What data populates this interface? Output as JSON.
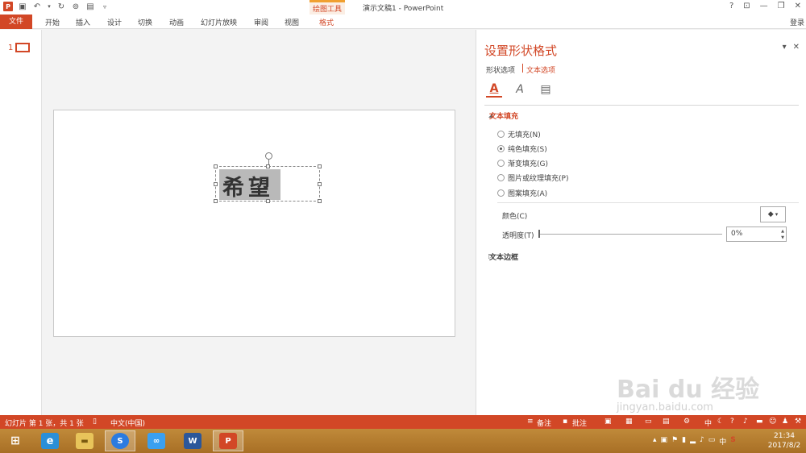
{
  "titlebar": {
    "doc_title": "演示文稿1 - PowerPoint",
    "tool_group": "绘图工具",
    "qat_icons": [
      "powerpoint-icon",
      "save-icon",
      "undo-icon",
      "redo-icon",
      "start-from-beginning-icon",
      "image-icon",
      "customize-qat-icon"
    ],
    "window_controls": [
      "?",
      "⊡",
      "—",
      "❐",
      "✕"
    ]
  },
  "ribbon": {
    "file": "文件",
    "tabs": [
      "开始",
      "插入",
      "设计",
      "切换",
      "动画",
      "幻灯片放映",
      "审阅",
      "视图",
      "格式"
    ],
    "login": "登录"
  },
  "thumbnails": {
    "slide_number": "1"
  },
  "slide": {
    "text": "希望"
  },
  "pane": {
    "title": "设置形状格式",
    "tab_shape": "形状选项",
    "tab_text": "文本选项",
    "section_fill": "文本填充",
    "fill_options": [
      {
        "label": "无填充(N)",
        "selected": false
      },
      {
        "label": "纯色填充(S)",
        "selected": true
      },
      {
        "label": "渐变填充(G)",
        "selected": false
      },
      {
        "label": "图片或纹理填充(P)",
        "selected": false
      },
      {
        "label": "图案填充(A)",
        "selected": false
      }
    ],
    "color_label": "颜色(C)",
    "transparency_label": "透明度(T)",
    "transparency_value": "0%",
    "transparency_fraction": 0,
    "section_border": "文本边框"
  },
  "status": {
    "slide_info": "幻灯片 第 1 张，共 1 张",
    "language": "中文(中国)",
    "notes": "备注",
    "comments": "批注"
  },
  "taskbar": {
    "time": "21:34",
    "date": "2017/8/2",
    "tray_ime": "中"
  },
  "watermark": {
    "text": "Bai du 经验",
    "sub": "jingyan.baidu.com"
  },
  "colors": {
    "accent": "#d24726",
    "taskbar": "#b07a2d"
  }
}
